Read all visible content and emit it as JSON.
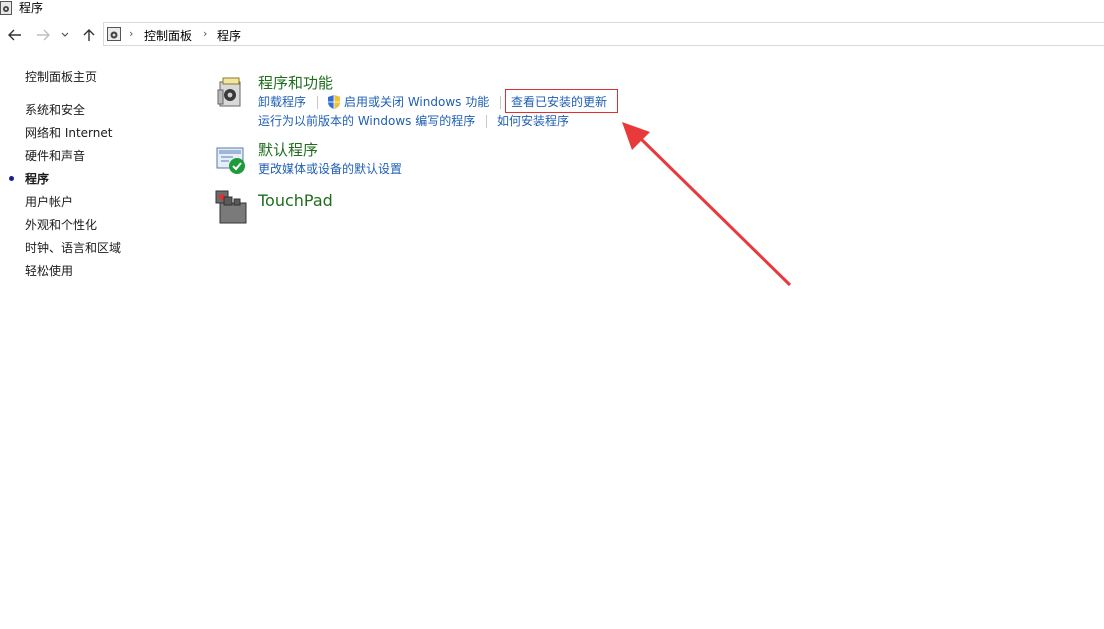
{
  "window": {
    "title": "程序",
    "icon": "control-panel-icon"
  },
  "nav": {
    "back_icon": "back-arrow-icon",
    "forward_icon": "forward-arrow-icon",
    "recent_icon": "chevron-down-icon",
    "up_icon": "up-arrow-icon"
  },
  "breadcrumb": {
    "items": [
      "控制面板",
      "程序"
    ]
  },
  "sidebar": {
    "home": "控制面板主页",
    "items": [
      {
        "label": "系统和安全"
      },
      {
        "label": "网络和 Internet"
      },
      {
        "label": "硬件和声音"
      },
      {
        "label": "程序",
        "active": true
      },
      {
        "label": "用户帐户"
      },
      {
        "label": "外观和个性化"
      },
      {
        "label": "时钟、语言和区域"
      },
      {
        "label": "轻松使用"
      }
    ]
  },
  "categories": [
    {
      "title": "程序和功能",
      "icon": "programs-features-icon",
      "links_row1": [
        "卸载程序",
        "启用或关闭 Windows 功能",
        "查看已安装的更新"
      ],
      "links_row2": [
        "运行为以前版本的 Windows 编写的程序",
        "如何安装程序"
      ]
    },
    {
      "title": "默认程序",
      "icon": "default-programs-icon",
      "links_row1": [
        "更改媒体或设备的默认设置"
      ]
    },
    {
      "title": "TouchPad",
      "icon": "touchpad-icon"
    }
  ],
  "annotation": {
    "highlight_color": "#e03030",
    "arrow_color": "#e83a3a"
  },
  "colors": {
    "link": "#1f5fb4",
    "category_title": "#1e6e1e"
  }
}
